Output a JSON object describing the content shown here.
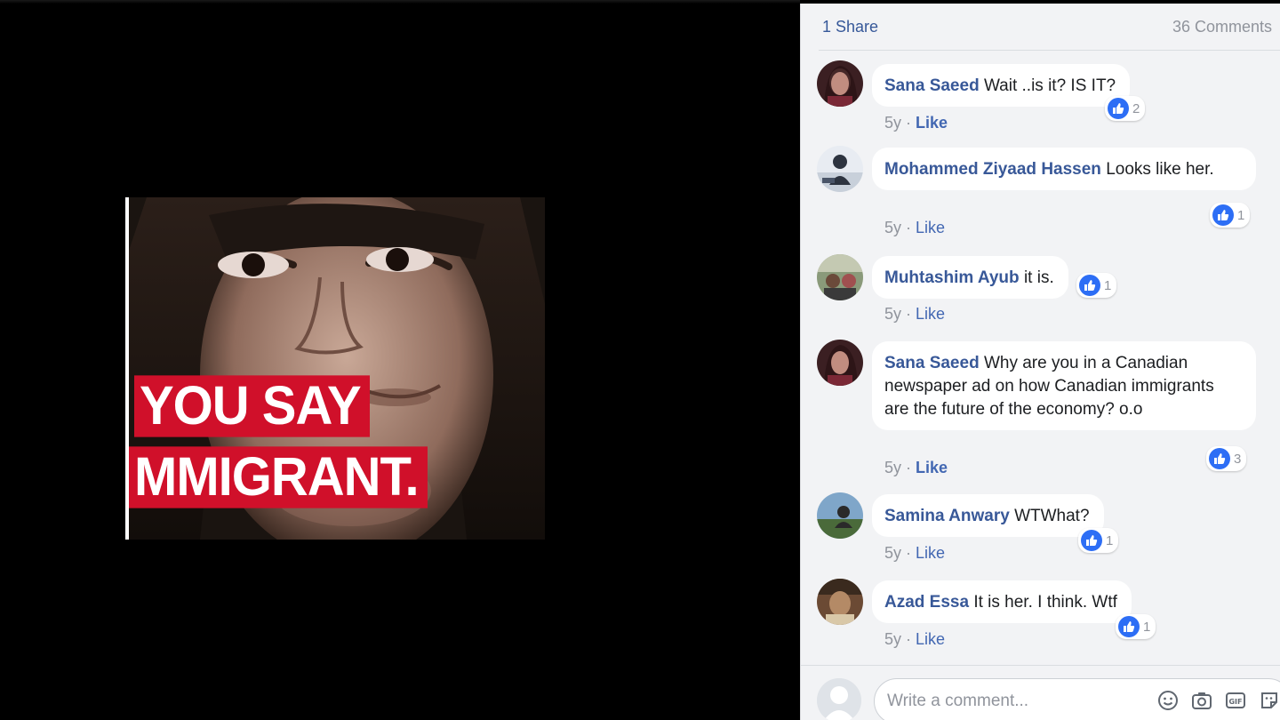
{
  "post": {
    "photo": {
      "banner_line1": "YOU SAY",
      "banner_line2": "MMIGRANT."
    }
  },
  "panel": {
    "shares": "1 Share",
    "comments_count": "36 Comments"
  },
  "comments": [
    {
      "author": "Sana Saeed",
      "text": "Wait ..is it? IS IT?",
      "time": "5y",
      "sep": " · ",
      "like": "Like",
      "reactions": "2"
    },
    {
      "author": "Mohammed Ziyaad Hassen",
      "text": "Looks like her.",
      "time": "5y",
      "sep": " · ",
      "like": "Like",
      "reactions": "1"
    },
    {
      "author": "Muhtashim Ayub",
      "text": "it is.",
      "time": "5y",
      "sep": " · ",
      "like": "Like",
      "reactions": "1"
    },
    {
      "author": "Sana Saeed",
      "text": "Why are you in a Canadian newspaper ad on how Canadian immigrants are the future of the economy? o.o",
      "time": "5y",
      "sep": " · ",
      "like": "Like",
      "reactions": "3"
    },
    {
      "author": "Samina Anwary",
      "text": "WTWhat?",
      "time": "5y",
      "sep": " · ",
      "like": "Like",
      "reactions": "1"
    },
    {
      "author": "Azad Essa",
      "text": "It is her. I think. Wtf",
      "time": "5y",
      "sep": " · ",
      "like": "Like",
      "reactions": "1"
    }
  ],
  "composer": {
    "placeholder": "Write a comment...",
    "icons": [
      "emoji-icon",
      "camera-icon",
      "gif-icon",
      "sticker-icon"
    ],
    "gif_label": "GIF"
  },
  "colors": {
    "link": "#385898",
    "like_blue": "#2d6ef5",
    "banner_red": "#d0102a"
  }
}
